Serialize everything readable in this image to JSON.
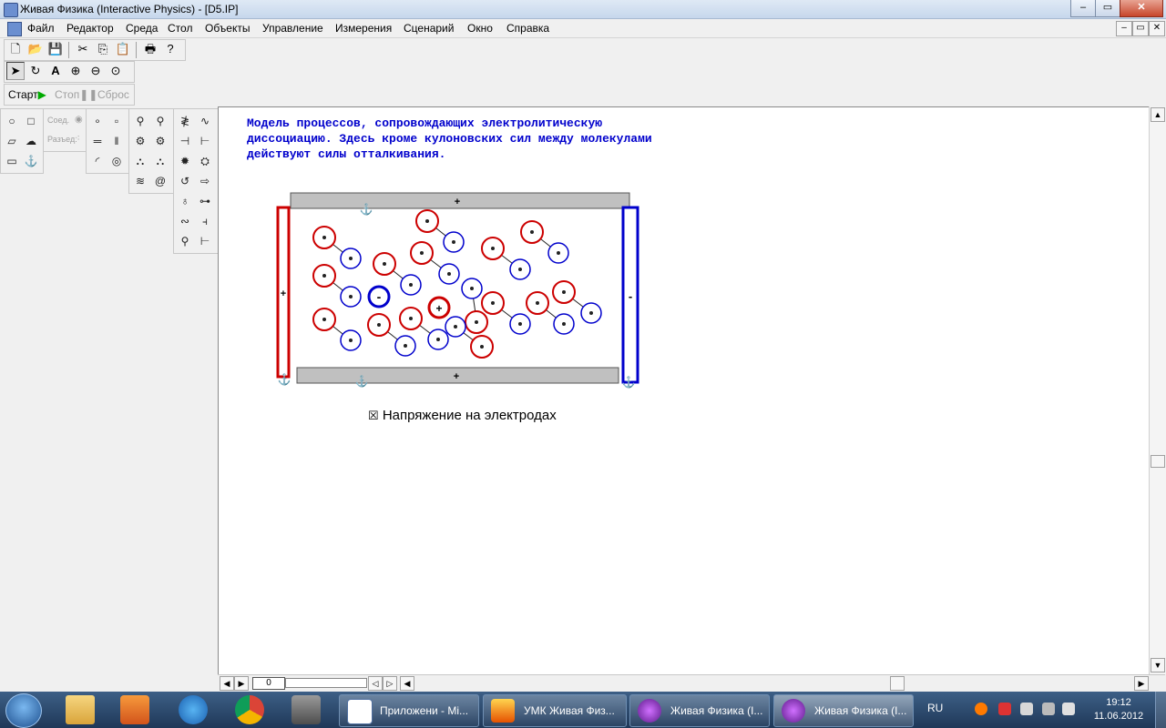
{
  "window": {
    "title": "Живая Физика (Interactive Physics) - [D5.IP]",
    "buttons": [
      "–",
      "▭",
      "✕"
    ],
    "doc_buttons": [
      "–",
      "▭",
      "✕"
    ]
  },
  "menu": [
    "Файл",
    "Редактор",
    "Среда",
    "Стол",
    "Объекты",
    "Управление",
    "Измерения",
    "Сценарий",
    "Окно",
    "Справка"
  ],
  "run": {
    "start": "Старт",
    "stop": "Стоп",
    "reset": "Сброс"
  },
  "palette": {
    "join": "Соед.",
    "split": "Разъед."
  },
  "description": [
    "Модель процессов, сопровождающих электролитическую",
    "диссоциацию. Здесь кроме кулоновских сил между молекулами",
    "действуют силы отталкивания."
  ],
  "electrodes": {
    "left_sign": "+",
    "right_sign": "-",
    "top_sign": "+",
    "bottom_sign": "+",
    "anode_color": "#cc0000",
    "cathode_color": "#0000cc"
  },
  "ions": {
    "cation_sign": "+",
    "anion_sign": "-"
  },
  "checkbox": {
    "label": "Напряжение на электродах",
    "checked": true
  },
  "frame_counter": "0",
  "colors": {
    "text_blue": "#0000cc",
    "cation": "#cc0000",
    "anion": "#0000cc"
  },
  "taskbar": {
    "items": [
      "Приложени - Mi...",
      "УМК Живая Физ...",
      "Живая Физика (I...",
      "Живая Физика (I..."
    ],
    "lang": "RU",
    "time": "19:12",
    "date": "11.06.2012"
  }
}
